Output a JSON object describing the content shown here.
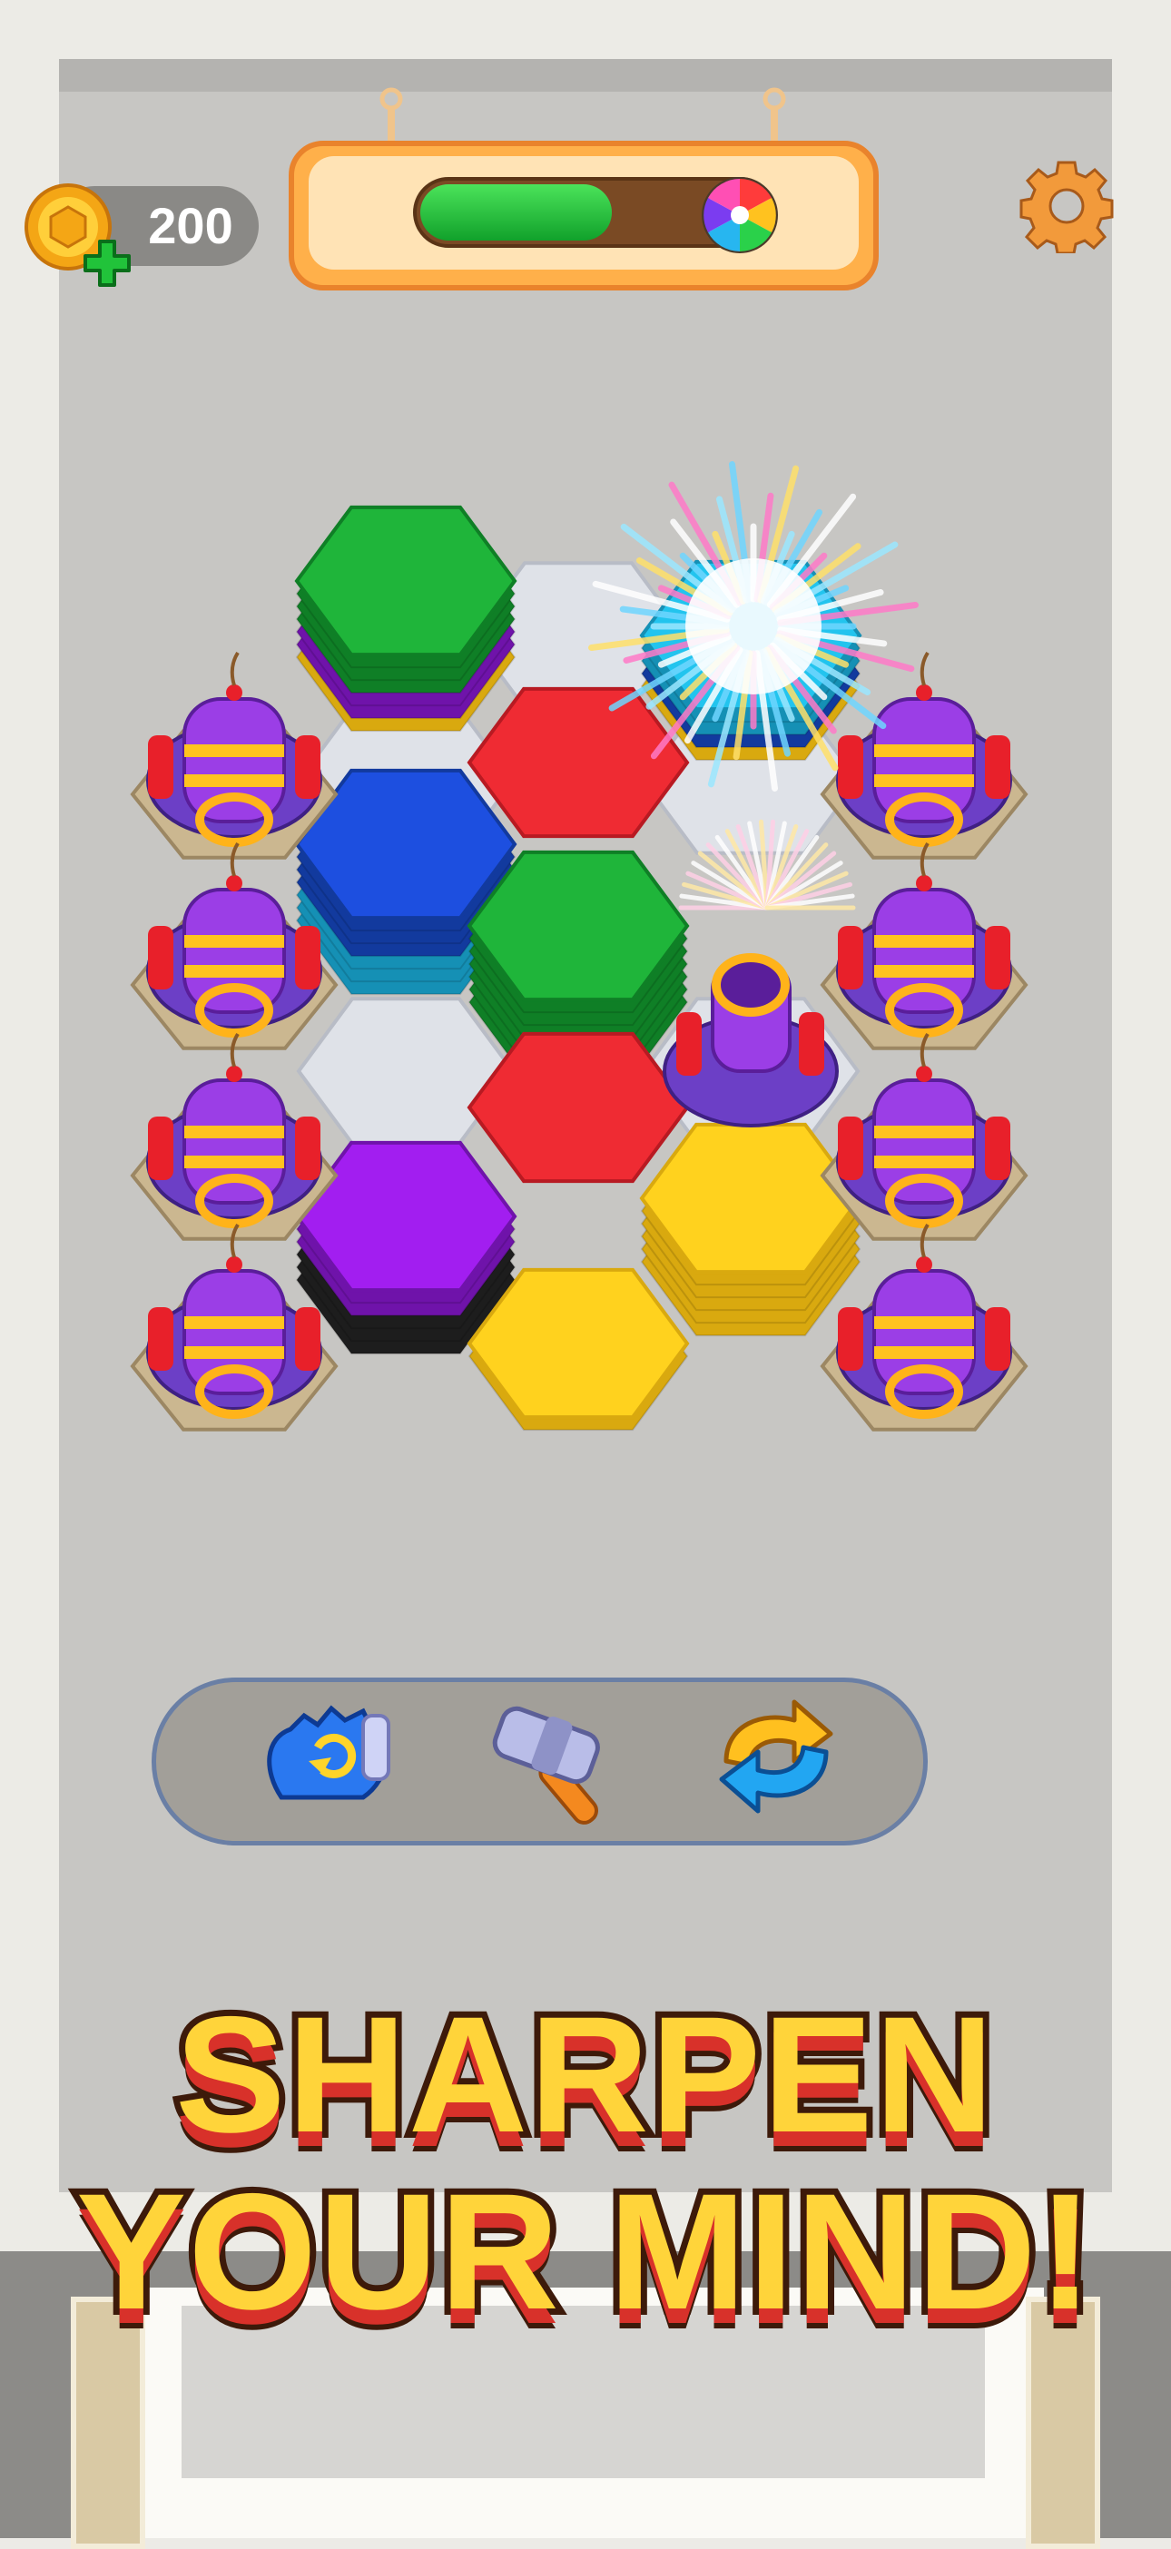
{
  "hud": {
    "coins": "200",
    "level_progress": 0.55,
    "coin_icon": "gold-coin-icon",
    "add_coins_icon": "green-plus-icon",
    "prize_icon": "rainbow-candy-icon",
    "settings_icon": "gear-icon"
  },
  "boosters": [
    {
      "name": "swap-glove",
      "icon": "glove-swap-icon"
    },
    {
      "name": "hammer",
      "icon": "hammer-icon"
    },
    {
      "name": "shuffle",
      "icon": "shuffle-arrows-icon"
    }
  ],
  "slogan": {
    "line1": "SHARPEN",
    "line2": "YOUR MIND!"
  },
  "colors": {
    "green": "#1fb53a",
    "blue": "#1d4fe0",
    "cyan": "#22c4ee",
    "red": "#ef2b33",
    "purple": "#a21ef0",
    "yellow": "#ffd21e",
    "black": "#333333",
    "accent_orange": "#f7a43d"
  },
  "board_stacks": [
    {
      "id": "stack-green-top",
      "top": "green",
      "layers": [
        "green",
        "green",
        "green",
        "green",
        "purple",
        "purple",
        "yellow"
      ]
    },
    {
      "id": "stack-cyan-top",
      "top": "cyan",
      "layers": [
        "cyan",
        "cyan",
        "cyan",
        "blue",
        "yellow"
      ]
    },
    {
      "id": "stack-blue",
      "top": "blue",
      "layers": [
        "blue",
        "blue",
        "blue",
        "blue",
        "cyan",
        "cyan",
        "cyan"
      ]
    },
    {
      "id": "stack-red-top",
      "top": "red",
      "layers": [
        "red"
      ]
    },
    {
      "id": "stack-green-mid",
      "top": "green",
      "layers": [
        "green",
        "green",
        "green",
        "green",
        "green",
        "green",
        "green"
      ]
    },
    {
      "id": "stack-purple",
      "top": "purple",
      "layers": [
        "purple",
        "purple",
        "purple",
        "black",
        "black",
        "black"
      ]
    },
    {
      "id": "stack-red-low",
      "top": "red",
      "layers": [
        "red"
      ]
    },
    {
      "id": "stack-yellow-front",
      "top": "yellow",
      "layers": [
        "yellow",
        "yellow"
      ]
    },
    {
      "id": "stack-yellow-right",
      "top": "yellow",
      "layers": [
        "yellow",
        "yellow",
        "yellow",
        "yellow",
        "yellow",
        "yellow"
      ]
    }
  ]
}
